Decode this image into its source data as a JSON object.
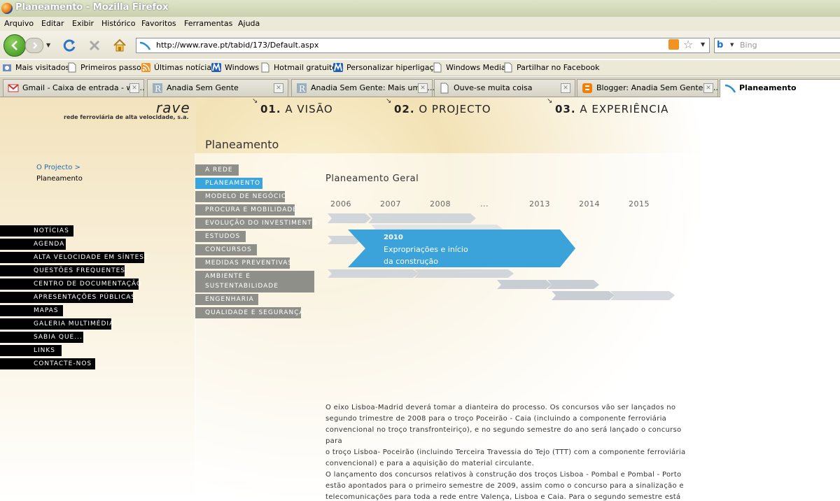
{
  "window": {
    "title": "Planeamento - Mozilla Firefox"
  },
  "menu": [
    "Arquivo",
    "Editar",
    "Exibir",
    "Histórico",
    "Favoritos",
    "Ferramentas",
    "Ajuda"
  ],
  "address": {
    "url": "http://www.rave.pt/tabid/173/Default.aspx"
  },
  "search": {
    "engine": "b",
    "placeholder": "Bing"
  },
  "bookmarks": [
    "Mais visitados",
    "Primeiros passos",
    "Últimas notícias",
    "Windows",
    "Hotmail gratuito",
    "Personalizar hiperligaç...",
    "Windows Media",
    "Partilhar no Facebook"
  ],
  "tabs": [
    "Gmail - Caixa de entrada - wo...",
    "Anadia Sem Gente",
    "Anadia Sem Gente: Mais uma ...",
    "Ouve-se muita coisa",
    "Blogger: Anadia Sem Gente - ...",
    "Planeamento"
  ],
  "site": {
    "logo": "rave",
    "tagline": "rede ferroviária de alta velocidade, s.a.",
    "topnav": [
      {
        "num": "01.",
        "label": "A VISÃO"
      },
      {
        "num": "02.",
        "label": "O PROJECTO"
      },
      {
        "num": "03.",
        "label": "A EXPERIÊNCIA"
      }
    ],
    "page_title": "Planeamento",
    "breadcrumb": {
      "parent": "O Projecto >",
      "current": "Planeamento"
    },
    "left_nav": [
      "NOTÍCIAS",
      "AGENDA",
      "ALTA VELOCIDADE EM SÍNTESE",
      "QUESTÕES FREQUENTES",
      "CENTRO DE DOCUMENTAÇÃO",
      "APRESENTAÇÕES PÚBLICAS",
      "MAPAS",
      "GALERIA MULTIMÉDIA",
      "SABIA QUE...",
      "LINKS",
      "CONTACTE-NOS"
    ],
    "sub_nav": [
      "A REDE",
      "PLANEAMENTO",
      "MODELO DE NEGÓCIO",
      "PROCURA E MOBILIDADE",
      "EVOLUÇÃO DO INVESTIMENTO",
      "ESTUDOS",
      "CONCURSOS",
      "MEDIDAS PREVENTIVAS",
      "AMBIENTE E",
      "SUSTENTABILIDADE",
      "ENGENHARIA",
      "QUALIDADE E SEGURANÇA"
    ],
    "section_title": "Planeamento Geral",
    "timeline": {
      "years": [
        "2006",
        "2007",
        "2008",
        "...",
        "2013",
        "2014",
        "2015"
      ],
      "highlight": {
        "year": "2010",
        "line1": "Expropriações e início",
        "line2": "da construção"
      }
    },
    "body_lines": [
      "O eixo Lisboa-Madrid deverá tomar a dianteira do processo. Os concursos vão ser lançados no",
      "segundo trimestre de 2008 para o troço Poceirão - Caia (incluindo a componente ferroviária",
      "convencional no troço transfronteiriço), e no segundo semestre do ano será lançado o concurso para",
      "o troço Lisboa- Poceirão (incluindo Terceira Travessia do Tejo (TTT) com a componente ferroviária",
      "convencional) e para a aquisição do material circulante.",
      "O lançamento dos concursos relativos à construção dos troços Lisboa - Pombal e Pombal - Porto",
      "estão apontados para o primeiro semestre de 2009, assim como o concurso para a sinalização e",
      "telecomunicações para toda a rede entre Valença, Lisboa e Caia.  Para o segundo semestre  está"
    ]
  }
}
